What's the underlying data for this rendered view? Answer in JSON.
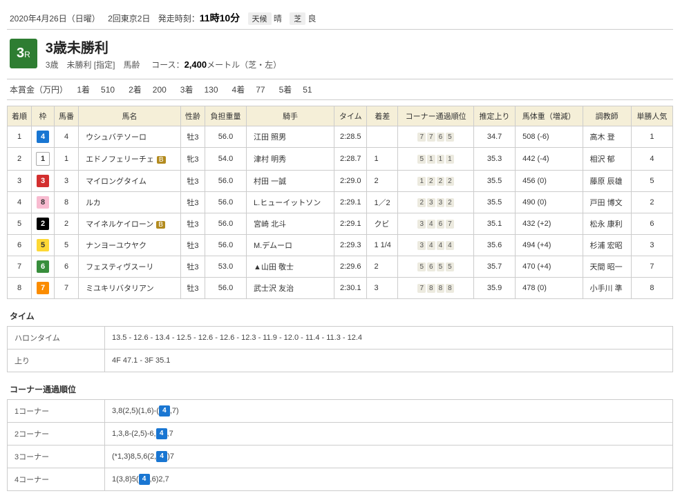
{
  "header": {
    "date": "2020年4月26日（日曜）",
    "meeting": "2回東京2日",
    "post_label": "発走時刻：",
    "post_time": "11時10分",
    "weather_label": "天候",
    "weather": "晴",
    "turf_label": "芝",
    "turf_cond": "良"
  },
  "race": {
    "number": "3",
    "number_suffix": "R",
    "title": "3歳未勝利",
    "cond_line_a": "3歳　未勝利 [指定]　馬齢",
    "course_label": "コース：",
    "course_dist": "2,400",
    "course_suffix": "メートル（芝・左）"
  },
  "prize": {
    "label": "本賞金（万円）",
    "items": [
      {
        "rank": "1着",
        "amount": "510"
      },
      {
        "rank": "2着",
        "amount": "200"
      },
      {
        "rank": "3着",
        "amount": "130"
      },
      {
        "rank": "4着",
        "amount": "77"
      },
      {
        "rank": "5着",
        "amount": "51"
      }
    ]
  },
  "table": {
    "headers": [
      "着順",
      "枠",
      "馬番",
      "馬名",
      "性齢",
      "負担重量",
      "騎手",
      "タイム",
      "着差",
      "コーナー通過順位",
      "推定上り",
      "馬体重（増減）",
      "調教師",
      "単勝人気"
    ],
    "rows": [
      {
        "place": "1",
        "waku": "4",
        "num": "4",
        "horse": "ウシュバテソーロ",
        "blinker": false,
        "sexage": "牡3",
        "weight": "56.0",
        "jockey": "江田 照男",
        "time": "2:28.5",
        "margin": "",
        "corners": [
          "7",
          "7",
          "6",
          "5"
        ],
        "agari": "34.7",
        "body": "508 (-6)",
        "trainer": "高木 登",
        "pop": "1"
      },
      {
        "place": "2",
        "waku": "1",
        "num": "1",
        "horse": "エドノフェリーチェ",
        "blinker": true,
        "sexage": "牝3",
        "weight": "54.0",
        "jockey": "津村 明秀",
        "time": "2:28.7",
        "margin": "1",
        "corners": [
          "5",
          "1",
          "1",
          "1"
        ],
        "agari": "35.3",
        "body": "442 (-4)",
        "trainer": "相沢 郁",
        "pop": "4"
      },
      {
        "place": "3",
        "waku": "3",
        "num": "3",
        "horse": "マイロングタイム",
        "blinker": false,
        "sexage": "牡3",
        "weight": "56.0",
        "jockey": "村田 一誠",
        "time": "2:29.0",
        "margin": "2",
        "corners": [
          "1",
          "2",
          "2",
          "2"
        ],
        "agari": "35.5",
        "body": "456 (0)",
        "trainer": "藤原 辰雄",
        "pop": "5"
      },
      {
        "place": "4",
        "waku": "8",
        "num": "8",
        "horse": "ルカ",
        "blinker": false,
        "sexage": "牡3",
        "weight": "56.0",
        "jockey": "L.ヒューイットソン",
        "time": "2:29.1",
        "margin": "1／2",
        "corners": [
          "2",
          "3",
          "3",
          "2"
        ],
        "agari": "35.5",
        "body": "490 (0)",
        "trainer": "戸田 博文",
        "pop": "2"
      },
      {
        "place": "5",
        "waku": "2",
        "num": "2",
        "horse": "マイネルケイローン",
        "blinker": true,
        "sexage": "牡3",
        "weight": "56.0",
        "jockey": "宮崎 北斗",
        "time": "2:29.1",
        "margin": "クビ",
        "corners": [
          "3",
          "4",
          "6",
          "7"
        ],
        "agari": "35.1",
        "body": "432 (+2)",
        "trainer": "松永 康利",
        "pop": "6"
      },
      {
        "place": "6",
        "waku": "5",
        "num": "5",
        "horse": "ナンヨーユウヤク",
        "blinker": false,
        "sexage": "牡3",
        "weight": "56.0",
        "jockey": "M.デムーロ",
        "time": "2:29.3",
        "margin": "1 1/4",
        "corners": [
          "3",
          "4",
          "4",
          "4"
        ],
        "agari": "35.6",
        "body": "494 (+4)",
        "trainer": "杉浦 宏昭",
        "pop": "3"
      },
      {
        "place": "7",
        "waku": "6",
        "num": "6",
        "horse": "フェスティヴスーリ",
        "blinker": false,
        "sexage": "牡3",
        "weight": "53.0",
        "jockey": "▲山田 敬士",
        "time": "2:29.6",
        "margin": "2",
        "corners": [
          "5",
          "6",
          "5",
          "5"
        ],
        "agari": "35.7",
        "body": "470 (+4)",
        "trainer": "天間 昭一",
        "pop": "7"
      },
      {
        "place": "8",
        "waku": "7",
        "num": "7",
        "horse": "ミユキリバタリアン",
        "blinker": false,
        "sexage": "牡3",
        "weight": "56.0",
        "jockey": "武士沢 友治",
        "time": "2:30.1",
        "margin": "3",
        "corners": [
          "7",
          "8",
          "8",
          "8"
        ],
        "agari": "35.9",
        "body": "478 (0)",
        "trainer": "小手川 準",
        "pop": "8"
      }
    ]
  },
  "time_section": {
    "title": "タイム",
    "halontime_label": "ハロンタイム",
    "halontime": "13.5 - 12.6 - 13.4 - 12.5 - 12.6 - 12.6 - 12.3 - 11.9 - 12.0 - 11.4 - 11.3 - 12.4",
    "agari_label": "上り",
    "agari": "4F 47.1 - 3F 35.1"
  },
  "corner_section": {
    "title": "コーナー通過順位",
    "rows": [
      {
        "label": "1コーナー",
        "pre": "3,8(2,5)(1,6)-(",
        "mark": "4",
        "post": ",7)"
      },
      {
        "label": "2コーナー",
        "pre": "1,3,8-(2,5)-6,",
        "mark": "4",
        "post": ",7"
      },
      {
        "label": "3コーナー",
        "pre": "(*1,3)8,5,6(2,",
        "mark": "4",
        "post": ")7"
      },
      {
        "label": "4コーナー",
        "pre": "1(3,8)5(",
        "mark": "4",
        "post": ",6)2,7"
      }
    ]
  }
}
